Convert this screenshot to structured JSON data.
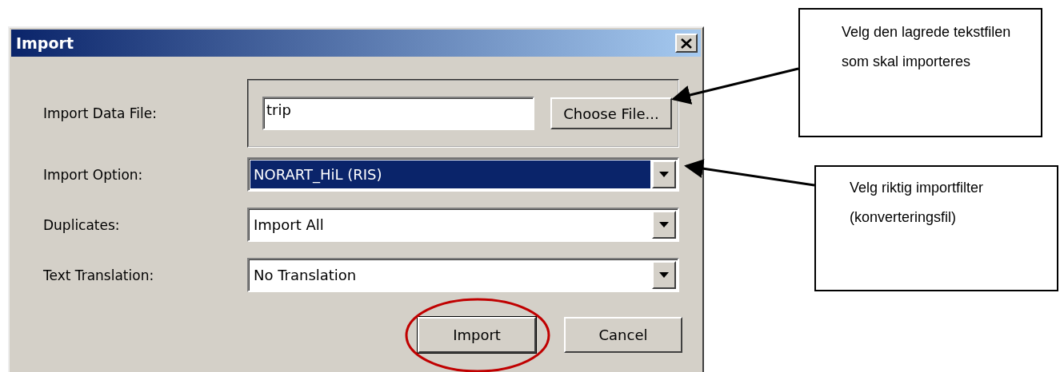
{
  "window": {
    "title": "Import"
  },
  "fields": [
    {
      "kind": "file",
      "label": "Import Data File:",
      "value": "trip",
      "button": "Choose File..."
    },
    {
      "kind": "combo",
      "label": "Import Option:",
      "value": "NORART_HiL (RIS)",
      "selected": true
    },
    {
      "kind": "combo",
      "label": "Duplicates:",
      "value": "Import All",
      "selected": false
    },
    {
      "kind": "combo",
      "label": "Text Translation:",
      "value": "No Translation",
      "selected": false
    }
  ],
  "buttons": [
    {
      "label": "Import",
      "circled": true
    },
    {
      "label": "Cancel",
      "circled": false
    }
  ],
  "callouts": [
    {
      "text": "Velg den lagrede tekstfilen som skal importeres"
    },
    {
      "text": "Velg riktig importfilter (konverteringsfil)"
    }
  ]
}
